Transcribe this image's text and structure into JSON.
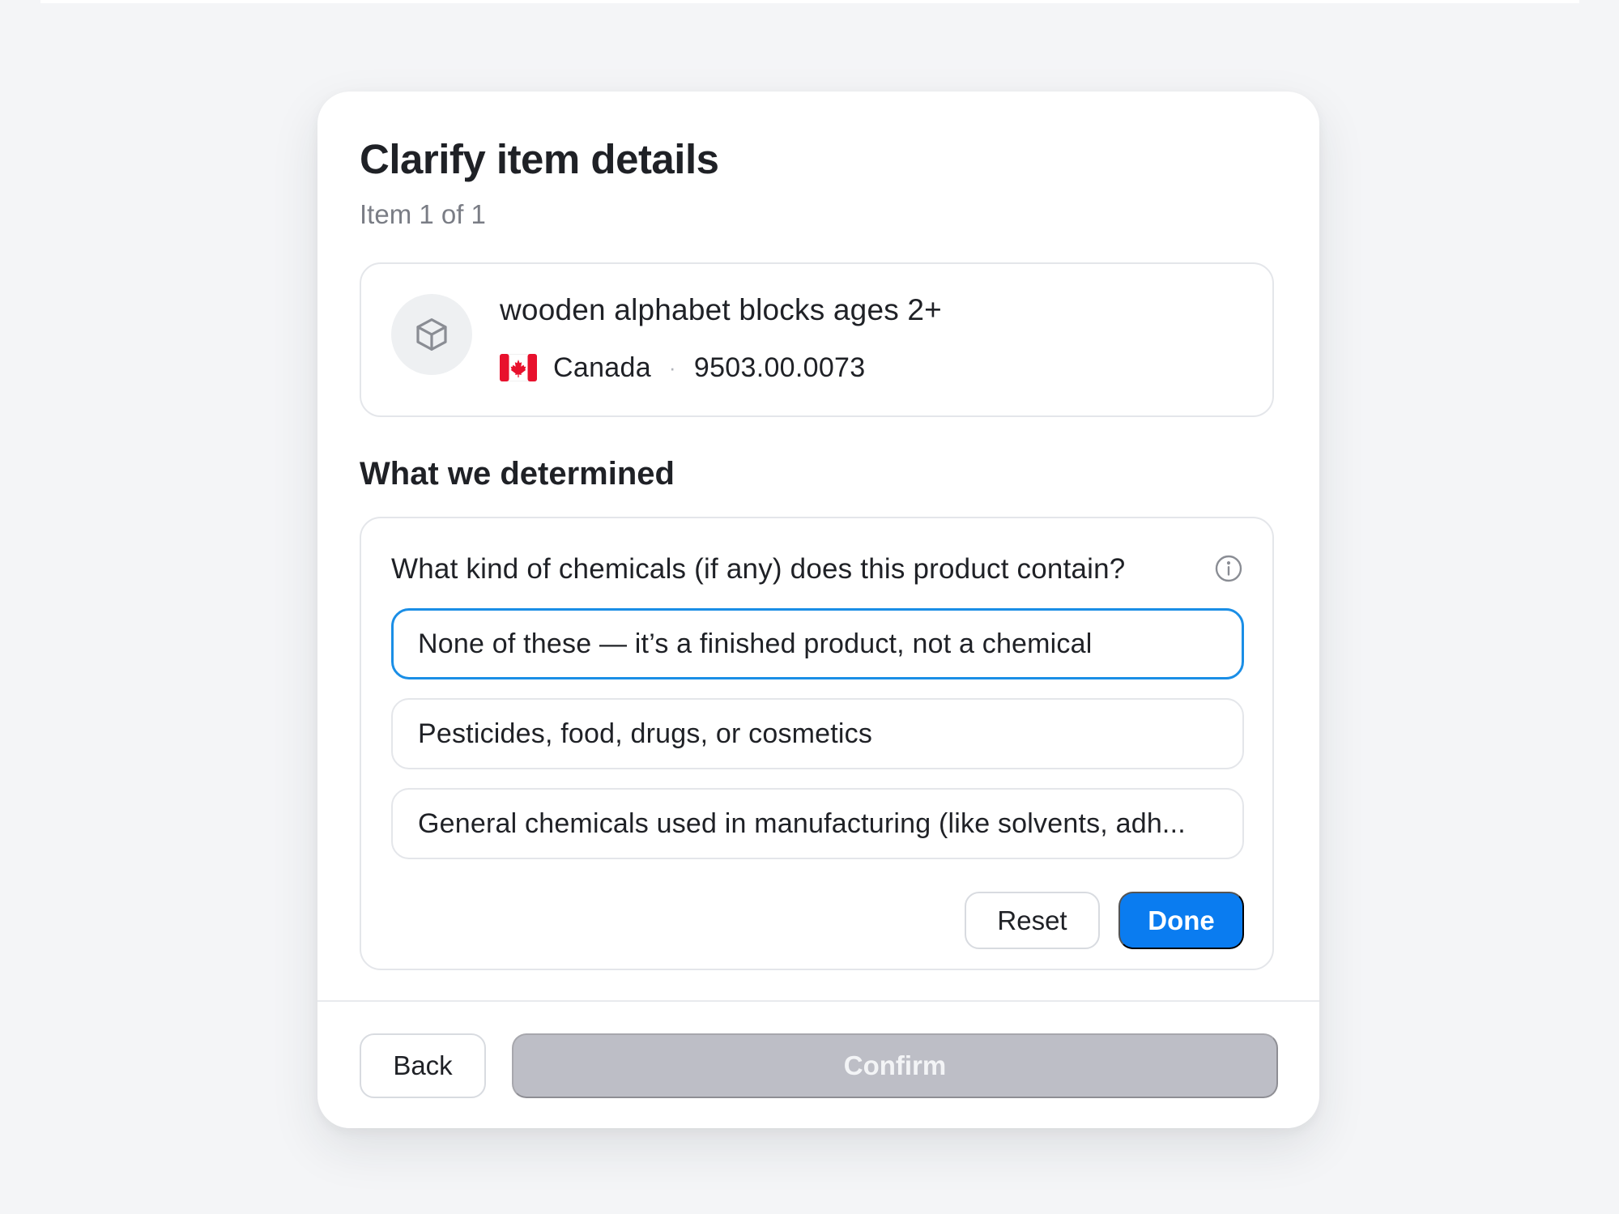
{
  "dialog": {
    "title": "Clarify item details",
    "progress": "Item 1 of 1"
  },
  "item": {
    "icon": "box-icon",
    "name": "wooden alphabet blocks ages 2+",
    "country": "Canada",
    "country_flag": "canada-flag-icon",
    "hs_code": "9503.00.0073",
    "separator": "·"
  },
  "determined": {
    "section_title": "What we determined",
    "question": "What kind of chemicals (if any) does this product contain?",
    "info_icon": "info-icon",
    "options": [
      {
        "label": "None of these — it’s a finished product, not a chemical",
        "selected": true
      },
      {
        "label": "Pesticides, food, drugs, or cosmetics",
        "selected": false
      },
      {
        "label": "General chemicals used in manufacturing (like solvents, adh...",
        "selected": false
      }
    ],
    "reset_label": "Reset",
    "done_label": "Done"
  },
  "footer": {
    "back_label": "Back",
    "confirm_label": "Confirm",
    "confirm_enabled": false
  },
  "colors": {
    "accent": "#0a7cf0",
    "selected_border": "#1a8ee6",
    "disabled_button": "#bdbec6",
    "flag_red": "#e8112d"
  }
}
